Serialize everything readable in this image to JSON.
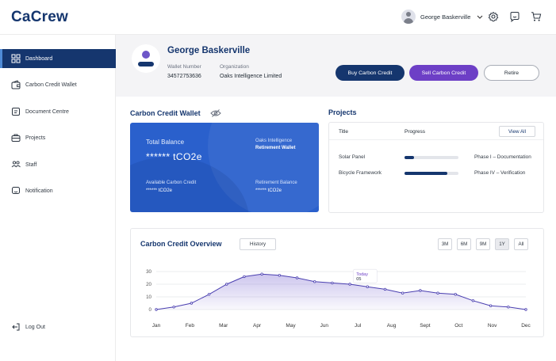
{
  "app": {
    "logo": "CaCrew"
  },
  "topbar": {
    "user_name": "George Baskerville",
    "icons": [
      "gear-icon",
      "chat-icon",
      "cart-icon"
    ]
  },
  "sidebar": {
    "items": [
      {
        "label": "Dashboard",
        "icon": "dashboard-icon",
        "active": true
      },
      {
        "label": "Carbon Credit Wallet",
        "icon": "wallet-icon"
      },
      {
        "label": "Document Centre",
        "icon": "document-icon"
      },
      {
        "label": "Projects",
        "icon": "briefcase-icon"
      },
      {
        "label": "Staff",
        "icon": "people-icon"
      },
      {
        "label": "Notification",
        "icon": "notification-icon"
      }
    ],
    "logout_label": "Log Out"
  },
  "profile": {
    "name": "George Baskerville",
    "wallet_label": "Wallet Number",
    "wallet_value": "34572753636",
    "org_label": "Organization",
    "org_value": "Oaks Intelligence Limited",
    "buy_label": "Buy Carbon Credit",
    "sell_label": "Sell Carbon Credit",
    "retire_label": "Retire"
  },
  "wallet": {
    "title": "Carbon Credit Wallet",
    "total_label": "Total Balance",
    "total_value": "****** tCO2e",
    "org_line1": "Oaks Intelligence",
    "org_line2": "Retirement Wallet",
    "available_label": "Available Carbon Credit",
    "available_value": "****** tCO2e",
    "retirement_label": "Retirement Balance",
    "retirement_value": "****** tCO2e"
  },
  "projects": {
    "title": "Projects",
    "col_title": "Title",
    "col_progress": "Progress",
    "view_all": "View All",
    "rows": [
      {
        "title": "Solar Panel",
        "progress": 0.18,
        "phase": "Phase I – Documentation"
      },
      {
        "title": "Bicycle Framework",
        "progress": 0.8,
        "phase": "Phase IV – Verification"
      }
    ]
  },
  "overview": {
    "title": "Carbon Credit Overview",
    "history_label": "History",
    "ranges": [
      "3M",
      "6M",
      "9M",
      "1Y",
      "All"
    ],
    "selected_range": "1Y",
    "tooltip_label": "Today",
    "tooltip_value": "05"
  },
  "colors": {
    "brand": "#15366e",
    "accent": "#6d3fc6",
    "card": "#2a60cc",
    "line": "#4a3fb0"
  },
  "chart_data": {
    "type": "area",
    "x": [
      "Jan",
      "Feb",
      "Mar",
      "Apr",
      "May",
      "Jun",
      "Jul",
      "Aug",
      "Sept",
      "Oct",
      "Nov",
      "Dec"
    ],
    "ylim": [
      0,
      30
    ],
    "yticks": [
      0,
      10,
      20,
      30
    ],
    "grid": true,
    "series": [
      {
        "values": [
          0,
          2,
          5,
          12,
          20,
          26,
          28,
          27,
          25,
          22,
          21,
          20,
          18,
          16,
          13,
          15,
          13,
          12,
          7,
          3,
          2,
          0
        ]
      }
    ]
  }
}
